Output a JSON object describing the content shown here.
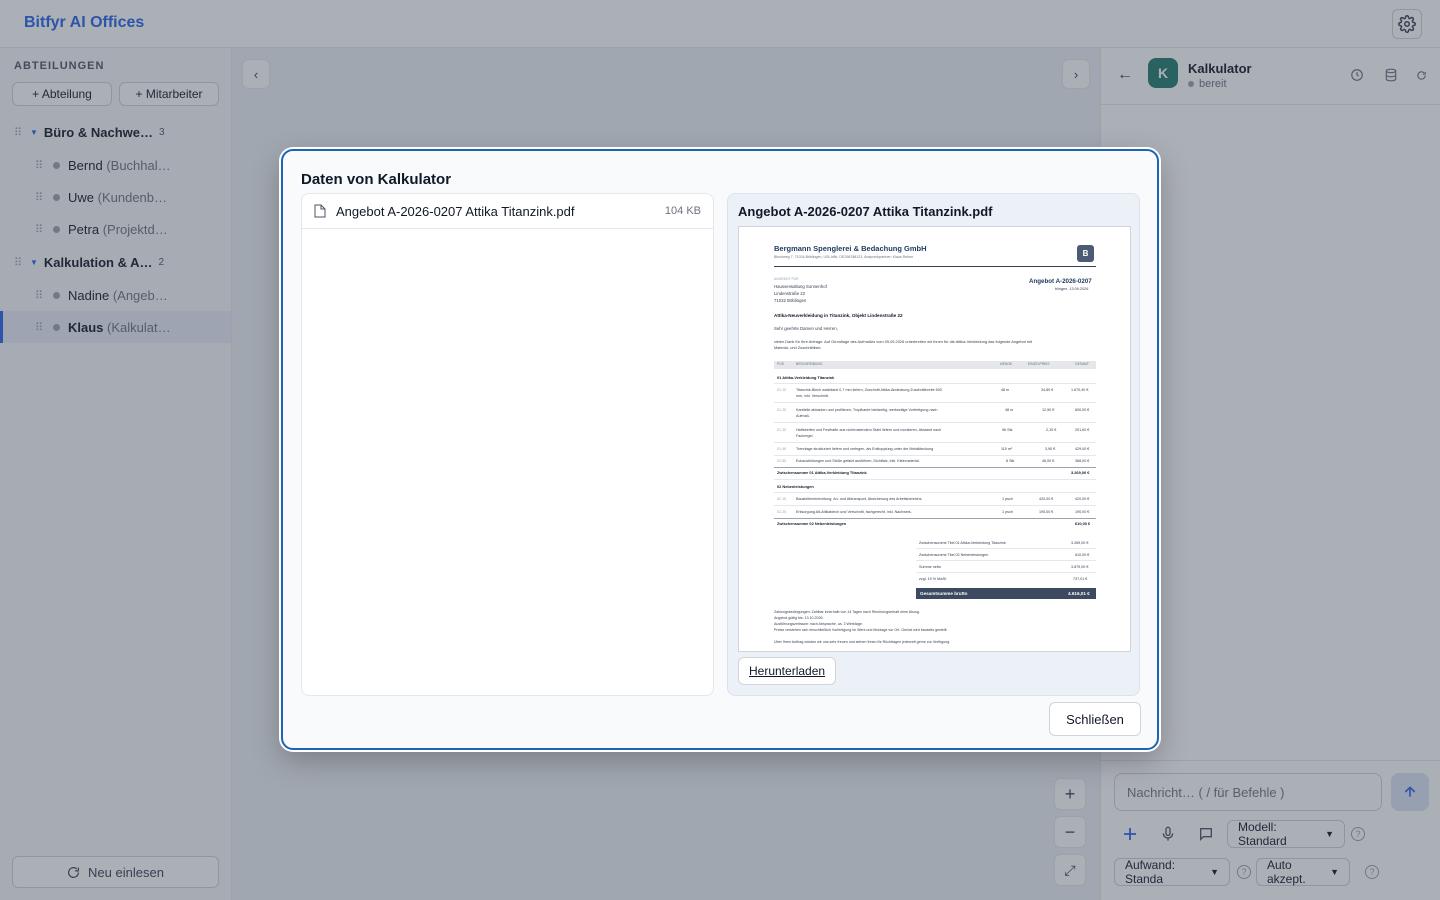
{
  "app": {
    "title": "Bitfyr AI Offices"
  },
  "sidebar": {
    "heading": "ABTEILUNGEN",
    "add_department": "+ Abteilung",
    "add_employee": "+ Mitarbeiter",
    "departments": [
      {
        "name": "Büro & Nachwe…",
        "count": "3",
        "employees": [
          {
            "name": "Bernd",
            "role": "(Buchhal…"
          },
          {
            "name": "Uwe",
            "role": "(Kundenb…"
          },
          {
            "name": "Petra",
            "role": "(Projektd…"
          }
        ]
      },
      {
        "name": "Kalkulation & A…",
        "count": "2",
        "employees": [
          {
            "name": "Nadine",
            "role": "(Angeb…"
          },
          {
            "name": "Klaus",
            "role": "(Kalkulat…"
          }
        ]
      }
    ],
    "reload": "Neu einlesen"
  },
  "canvas": {
    "prev": "‹",
    "next": "›",
    "zoom_in": "+",
    "zoom_out": "−",
    "fit": "⤢"
  },
  "chat": {
    "back": "←",
    "avatar_letter": "K",
    "name": "Kalkulator",
    "status": "bereit",
    "input_placeholder": "Nachricht… ( / für Befehle )",
    "model_select": "Modell: Standard",
    "effort_select": "Aufwand: Standa",
    "accept_select": "Auto akzept.",
    "help": "?"
  },
  "modal": {
    "title": "Daten von Kalkulator",
    "file": {
      "name": "Angebot A-2026-0207 Attika Titanzink.pdf",
      "size": "104 KB"
    },
    "preview_title": "Angebot A-2026-0207 Attika Titanzink.pdf",
    "download": "Herunterladen",
    "close": "Schließen"
  },
  "pdf": {
    "company": "Bergmann Spenglerei & Bedachung GmbH",
    "logo_letter": "B",
    "company_line": "Blechweg 7, 71034 Böblingen, USt-IdNr. DE298788123, Ansprechpartner: Klaus Reiner",
    "recipient_label": "ANGEBOT FÜR",
    "recipient": [
      "Hausverwaltung Sonnenhof",
      "Lindenstraße 22",
      "71032 Böblingen"
    ],
    "offer_no": "Angebot A-2026-0207",
    "offer_date": "blingen, 13.09.2026",
    "subject": "Attika-Neuverkleidung in Titanzink, Objekt Lindenstraße 22",
    "salutation": "Sehr geehrte Damen und Herren,",
    "intro1": "vielen Dank für Ihre Anfrage. Auf Grundlage des Aufmaßes vom 09.09.2026 unterbreiten wir Ihnen für die Attika-Verkleidung das folgende Angebot mit",
    "intro2": "Material- und Zuschnittliste.",
    "table_headers": {
      "pos": "POS",
      "desc": "BESCHREIBUNG",
      "qty": "MENGE",
      "unit": "EINZELPREIS",
      "total": "GESAMT"
    },
    "group1": "01   Attika-Verkleidung Titanzink",
    "rows1": [
      {
        "pos": "01.10",
        "desc": "Titanzink-Blech walzblank 0,7 mm liefern, Zuschnitt Attika-Abdeckung Zuschnittbreite 500",
        "desc2": "mm, inkl. Verschnitt.",
        "qty": "48 m",
        "unit": "34,80 €",
        "total": "1.670,40 €"
      },
      {
        "pos": "01.20",
        "desc": "Kantteile abkanten und profilieren, Tropfkante beidseitig, werkseitige Vorfertigung nach",
        "desc2": "Aufmaß.",
        "qty": "48 m",
        "unit": "12,50 €",
        "total": "600,00 €"
      },
      {
        "pos": "01.30",
        "desc": "Haftstreifen und Festhafte aus nichtrostendem Stahl liefern und montieren, Abstand nach",
        "desc2": "Fachregel.",
        "qty": "96 Stk",
        "unit": "2,10 €",
        "total": "201,60 €"
      },
      {
        "pos": "01.40",
        "desc": "Trennlage strukturiert liefern und verlegen, als Entkopplung unter der Metalldeckung.",
        "desc2": "",
        "qty": "110 m²",
        "unit": "3,90 €",
        "total": "429,00 €"
      },
      {
        "pos": "01.50",
        "desc": "Eckausbildungen und Stöße gefalzt ausführen, Dichtfalz, inkl. Kleinmaterial.",
        "desc2": "",
        "qty": "8 Stk",
        "unit": "46,00 €",
        "total": "368,00 €"
      }
    ],
    "subtotal1_label": "Zwischensumme 01 Attika-Verkleidung Titanzink",
    "subtotal1": "3.269,00 €",
    "group2": "02   Nebenleistungen",
    "rows2": [
      {
        "pos": "02.10",
        "desc": "Baustelleneinrichtung, An- und Abtransport, Absicherung des Arbeitsbereichs.",
        "qty": "1 psch",
        "unit": "420,00 €",
        "total": "420,00 €"
      },
      {
        "pos": "02.20",
        "desc": "Entsorgung Alt-Attikablech und Verschnitt, fachgerecht, inkl. Nachweis.",
        "qty": "1 psch",
        "unit": "190,00 €",
        "total": "190,00 €"
      }
    ],
    "subtotal2_label": "Zwischensumme 02 Nebenleistungen",
    "subtotal2": "610,00 €",
    "summary": [
      {
        "label": "Zwischensumme Titel 01 Attika-Verkleidung Titanzink",
        "value": "3.269,00 €"
      },
      {
        "label": "Zwischensumme Titel 02 Nebenleistungen",
        "value": "610,00 €"
      },
      {
        "label": "Summe netto",
        "value": "3.879,00 €"
      },
      {
        "label": "zzgl. 19 % MwSt",
        "value": "737,01 €"
      }
    ],
    "grand_label": "Gesamtsumme brutto",
    "grand_value": "4.616,01 €",
    "footer": [
      "Zahlungsbedingungen: Zahlbar innerhalb von 14 Tagen nach Rechnungserhalt ohne Abzug.",
      "Angebot gültig bis: 13.10.2026.",
      "Ausführungszeitraum: nach Absprache, ca. 3 Werktage.",
      "Preise verstehen sich einschließlich Vorfertigung im Werk und Montage vor Ort. Gerüst wird bauseits gestellt."
    ],
    "closing": "Über Ihren Auftrag würden wir uns sehr freuen und stehen Ihnen für Rückfragen jederzeit gerne zur Verfügung."
  }
}
